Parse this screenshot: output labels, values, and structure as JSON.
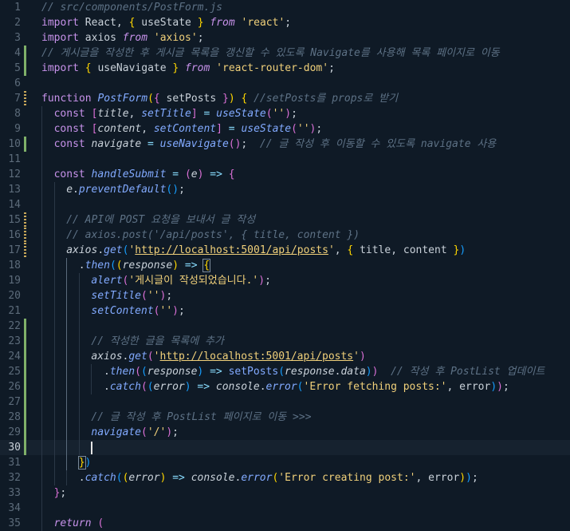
{
  "editor": {
    "file_comment": "// src/components/PostForm.js",
    "active_line": 30,
    "lines": [
      {
        "n": 1,
        "tokens": [
          {
            "t": "// src/components/PostForm.js",
            "c": "cm"
          }
        ]
      },
      {
        "n": 2,
        "tokens": [
          {
            "t": "import",
            "c": "kw"
          },
          {
            "t": " React, ",
            "c": "pl"
          },
          {
            "t": "{",
            "c": "br1"
          },
          {
            "t": " useState ",
            "c": "pl"
          },
          {
            "t": "}",
            "c": "br1"
          },
          {
            "t": " from",
            "c": "kwi"
          },
          {
            "t": " 'react'",
            "c": "str"
          },
          {
            "t": ";",
            "c": "pl"
          }
        ]
      },
      {
        "n": 3,
        "tokens": [
          {
            "t": "import",
            "c": "kw"
          },
          {
            "t": " axios ",
            "c": "pl"
          },
          {
            "t": "from",
            "c": "kwi"
          },
          {
            "t": " 'axios'",
            "c": "str"
          },
          {
            "t": ";",
            "c": "pl"
          }
        ]
      },
      {
        "n": 4,
        "mark": "added",
        "tokens": [
          {
            "t": "// 게시글을 작성한 후 게시글 목록을 갱신할 수 있도록 Navigate를 사용해 목록 페이지로 이동",
            "c": "cm"
          }
        ]
      },
      {
        "n": 5,
        "mark": "added",
        "tokens": [
          {
            "t": "import",
            "c": "kw"
          },
          {
            "t": " ",
            "c": "pl"
          },
          {
            "t": "{",
            "c": "br1"
          },
          {
            "t": " useNavigate ",
            "c": "pl"
          },
          {
            "t": "}",
            "c": "br1"
          },
          {
            "t": " from",
            "c": "kwi"
          },
          {
            "t": " 'react-router-dom'",
            "c": "str"
          },
          {
            "t": ";",
            "c": "pl"
          }
        ]
      },
      {
        "n": 6,
        "tokens": []
      },
      {
        "n": 7,
        "mark": "modified",
        "tokens": [
          {
            "t": "function",
            "c": "kw"
          },
          {
            "t": " PostForm",
            "c": "fni"
          },
          {
            "t": "(",
            "c": "br1"
          },
          {
            "t": "{",
            "c": "br2"
          },
          {
            "t": " setPosts ",
            "c": "pl"
          },
          {
            "t": "}",
            "c": "br2"
          },
          {
            "t": ")",
            "c": "br1"
          },
          {
            "t": " ",
            "c": "pl"
          },
          {
            "t": "{",
            "c": "br1"
          },
          {
            "t": " //setPosts를 props로 받기",
            "c": "cm"
          }
        ]
      },
      {
        "n": 8,
        "indent": 1,
        "tokens": [
          {
            "t": "const",
            "c": "kw"
          },
          {
            "t": " ",
            "c": "pl"
          },
          {
            "t": "[",
            "c": "br2"
          },
          {
            "t": "title",
            "c": "vari"
          },
          {
            "t": ", ",
            "c": "pl"
          },
          {
            "t": "setTitle",
            "c": "fni"
          },
          {
            "t": "]",
            "c": "br2"
          },
          {
            "t": " = ",
            "c": "op"
          },
          {
            "t": "useState",
            "c": "fni"
          },
          {
            "t": "(",
            "c": "br2"
          },
          {
            "t": "''",
            "c": "str"
          },
          {
            "t": ")",
            "c": "br2"
          },
          {
            "t": ";",
            "c": "pl"
          }
        ]
      },
      {
        "n": 9,
        "indent": 1,
        "tokens": [
          {
            "t": "const",
            "c": "kw"
          },
          {
            "t": " ",
            "c": "pl"
          },
          {
            "t": "[",
            "c": "br2"
          },
          {
            "t": "content",
            "c": "vari"
          },
          {
            "t": ", ",
            "c": "pl"
          },
          {
            "t": "setContent",
            "c": "fni"
          },
          {
            "t": "]",
            "c": "br2"
          },
          {
            "t": " = ",
            "c": "op"
          },
          {
            "t": "useState",
            "c": "fni"
          },
          {
            "t": "(",
            "c": "br2"
          },
          {
            "t": "''",
            "c": "str"
          },
          {
            "t": ")",
            "c": "br2"
          },
          {
            "t": ";",
            "c": "pl"
          }
        ]
      },
      {
        "n": 10,
        "indent": 1,
        "mark": "added",
        "tokens": [
          {
            "t": "const",
            "c": "kw"
          },
          {
            "t": " navigate",
            "c": "vari"
          },
          {
            "t": " = ",
            "c": "op"
          },
          {
            "t": "useNavigate",
            "c": "fni"
          },
          {
            "t": "()",
            "c": "br2"
          },
          {
            "t": ";",
            "c": "pl"
          },
          {
            "t": "  // 글 작성 후 이동할 수 있도록 navigate 사용",
            "c": "cm"
          }
        ]
      },
      {
        "n": 11,
        "indent": 1,
        "tokens": []
      },
      {
        "n": 12,
        "indent": 1,
        "tokens": [
          {
            "t": "const",
            "c": "kw"
          },
          {
            "t": " handleSubmit",
            "c": "fni"
          },
          {
            "t": " = ",
            "c": "op"
          },
          {
            "t": "(",
            "c": "br2"
          },
          {
            "t": "e",
            "c": "vari"
          },
          {
            "t": ")",
            "c": "br2"
          },
          {
            "t": " => ",
            "c": "op"
          },
          {
            "t": "{",
            "c": "br2"
          }
        ]
      },
      {
        "n": 13,
        "indent": 2,
        "tokens": [
          {
            "t": "e",
            "c": "vari"
          },
          {
            "t": ".",
            "c": "pl"
          },
          {
            "t": "preventDefault",
            "c": "fni"
          },
          {
            "t": "()",
            "c": "br3"
          },
          {
            "t": ";",
            "c": "pl"
          }
        ]
      },
      {
        "n": 14,
        "indent": 2,
        "tokens": []
      },
      {
        "n": 15,
        "indent": 2,
        "mark": "modified",
        "tokens": [
          {
            "t": "// API에 POST 요청을 보내서 글 작성",
            "c": "cm"
          }
        ]
      },
      {
        "n": 16,
        "indent": 2,
        "mark": "modified",
        "tokens": [
          {
            "t": "// axios.post('/api/posts', { title, content })",
            "c": "cm"
          }
        ]
      },
      {
        "n": 17,
        "indent": 2,
        "mark": "modified",
        "tokens": [
          {
            "t": "axios",
            "c": "vari"
          },
          {
            "t": ".",
            "c": "pl"
          },
          {
            "t": "get",
            "c": "fni"
          },
          {
            "t": "(",
            "c": "br3"
          },
          {
            "t": "'",
            "c": "str"
          },
          {
            "t": "http://localhost:5001/api/posts",
            "c": "url"
          },
          {
            "t": "'",
            "c": "str"
          },
          {
            "t": ", ",
            "c": "pl"
          },
          {
            "t": "{",
            "c": "br1"
          },
          {
            "t": " title, content ",
            "c": "pl"
          },
          {
            "t": "}",
            "c": "br1"
          },
          {
            "t": ")",
            "c": "br3"
          }
        ]
      },
      {
        "n": 18,
        "indent": 3,
        "tokens": [
          {
            "t": ".",
            "c": "pl"
          },
          {
            "t": "then",
            "c": "fni"
          },
          {
            "t": "(",
            "c": "br3"
          },
          {
            "t": "(",
            "c": "br1"
          },
          {
            "t": "response",
            "c": "vari"
          },
          {
            "t": ")",
            "c": "br1"
          },
          {
            "t": " => ",
            "c": "op"
          },
          {
            "t": "{",
            "c": "ab"
          }
        ]
      },
      {
        "n": 19,
        "indent": 4,
        "tokens": [
          {
            "t": "alert",
            "c": "fni"
          },
          {
            "t": "(",
            "c": "br2"
          },
          {
            "t": "'게시글이 작성되었습니다.'",
            "c": "str"
          },
          {
            "t": ")",
            "c": "br2"
          },
          {
            "t": ";",
            "c": "pl"
          }
        ]
      },
      {
        "n": 20,
        "indent": 4,
        "tokens": [
          {
            "t": "setTitle",
            "c": "fni"
          },
          {
            "t": "(",
            "c": "br2"
          },
          {
            "t": "''",
            "c": "str"
          },
          {
            "t": ")",
            "c": "br2"
          },
          {
            "t": ";",
            "c": "pl"
          }
        ]
      },
      {
        "n": 21,
        "indent": 4,
        "tokens": [
          {
            "t": "setContent",
            "c": "fni"
          },
          {
            "t": "(",
            "c": "br2"
          },
          {
            "t": "''",
            "c": "str"
          },
          {
            "t": ")",
            "c": "br2"
          },
          {
            "t": ";",
            "c": "pl"
          }
        ]
      },
      {
        "n": 22,
        "indent": 4,
        "mark": "added",
        "tokens": []
      },
      {
        "n": 23,
        "indent": 4,
        "mark": "added",
        "tokens": [
          {
            "t": "// 작성한 글을 목록에 추가",
            "c": "cm"
          }
        ]
      },
      {
        "n": 24,
        "indent": 4,
        "mark": "added",
        "tokens": [
          {
            "t": "axios",
            "c": "vari"
          },
          {
            "t": ".",
            "c": "pl"
          },
          {
            "t": "get",
            "c": "fni"
          },
          {
            "t": "(",
            "c": "br2"
          },
          {
            "t": "'",
            "c": "str"
          },
          {
            "t": "http://localhost:5001/api/posts",
            "c": "url"
          },
          {
            "t": "'",
            "c": "str"
          },
          {
            "t": ")",
            "c": "br2"
          }
        ]
      },
      {
        "n": 25,
        "indent": 5,
        "mark": "added",
        "tokens": [
          {
            "t": ".",
            "c": "pl"
          },
          {
            "t": "then",
            "c": "fni"
          },
          {
            "t": "(",
            "c": "br2"
          },
          {
            "t": "(",
            "c": "br3"
          },
          {
            "t": "response",
            "c": "vari"
          },
          {
            "t": ")",
            "c": "br3"
          },
          {
            "t": " => ",
            "c": "op"
          },
          {
            "t": "setPosts",
            "c": "fn"
          },
          {
            "t": "(",
            "c": "br3"
          },
          {
            "t": "response",
            "c": "vari"
          },
          {
            "t": ".",
            "c": "pl"
          },
          {
            "t": "data",
            "c": "vari"
          },
          {
            "t": ")",
            "c": "br3"
          },
          {
            "t": ")",
            "c": "br2"
          },
          {
            "t": "  // 작성 후 PostList 업데이트",
            "c": "cm"
          }
        ]
      },
      {
        "n": 26,
        "indent": 5,
        "mark": "added",
        "tokens": [
          {
            "t": ".",
            "c": "pl"
          },
          {
            "t": "catch",
            "c": "fni"
          },
          {
            "t": "(",
            "c": "br2"
          },
          {
            "t": "(",
            "c": "br3"
          },
          {
            "t": "error",
            "c": "vari"
          },
          {
            "t": ")",
            "c": "br3"
          },
          {
            "t": " => ",
            "c": "op"
          },
          {
            "t": "console",
            "c": "vari"
          },
          {
            "t": ".",
            "c": "pl"
          },
          {
            "t": "error",
            "c": "fni"
          },
          {
            "t": "(",
            "c": "br3"
          },
          {
            "t": "'Error fetching posts:'",
            "c": "str"
          },
          {
            "t": ", error",
            "c": "pl"
          },
          {
            "t": ")",
            "c": "br3"
          },
          {
            "t": ")",
            "c": "br2"
          },
          {
            "t": ";",
            "c": "pl"
          }
        ]
      },
      {
        "n": 27,
        "indent": 4,
        "mark": "added",
        "tokens": []
      },
      {
        "n": 28,
        "indent": 4,
        "mark": "added",
        "tokens": [
          {
            "t": "// 글 작성 후 PostList 페이지로 이동 >>>",
            "c": "cm"
          }
        ]
      },
      {
        "n": 29,
        "indent": 4,
        "mark": "added",
        "tokens": [
          {
            "t": "navigate",
            "c": "fni"
          },
          {
            "t": "(",
            "c": "br2"
          },
          {
            "t": "'/'",
            "c": "str"
          },
          {
            "t": ")",
            "c": "br2"
          },
          {
            "t": ";",
            "c": "pl"
          }
        ]
      },
      {
        "n": 30,
        "indent": 4,
        "mark": "added",
        "cursor": true,
        "tokens": []
      },
      {
        "n": 31,
        "indent": 3,
        "tokens": [
          {
            "t": "}",
            "c": "ab"
          },
          {
            "t": ")",
            "c": "br3"
          }
        ]
      },
      {
        "n": 32,
        "indent": 3,
        "tokens": [
          {
            "t": ".",
            "c": "pl"
          },
          {
            "t": "catch",
            "c": "fni"
          },
          {
            "t": "(",
            "c": "br3"
          },
          {
            "t": "(",
            "c": "br1"
          },
          {
            "t": "error",
            "c": "vari"
          },
          {
            "t": ")",
            "c": "br1"
          },
          {
            "t": " => ",
            "c": "op"
          },
          {
            "t": "console",
            "c": "vari"
          },
          {
            "t": ".",
            "c": "pl"
          },
          {
            "t": "error",
            "c": "fni"
          },
          {
            "t": "(",
            "c": "br1"
          },
          {
            "t": "'Error creating post:'",
            "c": "str"
          },
          {
            "t": ", error",
            "c": "pl"
          },
          {
            "t": ")",
            "c": "br1"
          },
          {
            "t": ")",
            "c": "br3"
          },
          {
            "t": ";",
            "c": "pl"
          }
        ]
      },
      {
        "n": 33,
        "indent": 1,
        "tokens": [
          {
            "t": "}",
            "c": "br2"
          },
          {
            "t": ";",
            "c": "pl"
          }
        ]
      },
      {
        "n": 34,
        "indent": 1,
        "tokens": []
      },
      {
        "n": 35,
        "indent": 1,
        "tokens": [
          {
            "t": "return",
            "c": "kwi"
          },
          {
            "t": " (",
            "c": "br2"
          }
        ]
      }
    ]
  }
}
